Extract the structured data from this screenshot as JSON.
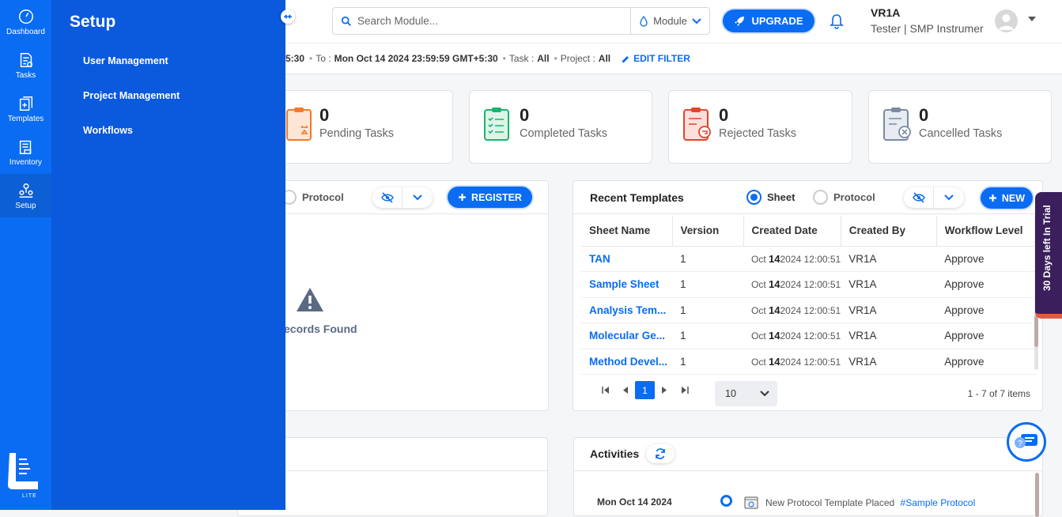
{
  "rail": {
    "items": [
      {
        "label": "Dashboard",
        "icon": "dashboard-icon"
      },
      {
        "label": "Tasks",
        "icon": "tasks-icon"
      },
      {
        "label": "Templates",
        "icon": "templates-icon"
      },
      {
        "label": "Inventory",
        "icon": "inventory-icon"
      },
      {
        "label": "Setup",
        "icon": "setup-icon"
      }
    ],
    "logo_text": "LITE"
  },
  "flyout": {
    "title": "Setup",
    "items": [
      "User Management",
      "Project Management",
      "Workflows"
    ]
  },
  "header": {
    "search_placeholder": "Search Module...",
    "module_label": "Module",
    "upgrade_label": "UPGRADE",
    "user_name": "VR1A",
    "user_role": "Tester | SMP Instrumer"
  },
  "filter": {
    "from_tail": "5:30",
    "to_label": "To :",
    "to_value": "Mon Oct 14 2024 23:59:59 GMT+5:30",
    "task_label": "Task :",
    "task_value": "All",
    "project_label": "Project :",
    "project_value": "All",
    "edit_label": "EDIT FILTER"
  },
  "stats": [
    {
      "count": "0",
      "label": "Pending Tasks"
    },
    {
      "count": "0",
      "label": "Completed Tasks"
    },
    {
      "count": "0",
      "label": "Rejected Tasks"
    },
    {
      "count": "0",
      "label": "Cancelled Tasks"
    }
  ],
  "left_panel": {
    "radio_label": "Protocol",
    "register_label": "REGISTER",
    "empty_text": "ecords Found"
  },
  "templates": {
    "title": "Recent Templates",
    "radio_sheet": "Sheet",
    "radio_protocol": "Protocol",
    "new_label": "NEW",
    "columns": [
      "Sheet Name",
      "Version",
      "Created Date",
      "Created By",
      "Workflow Level"
    ],
    "rows": [
      {
        "name": "TAN",
        "version": "1",
        "month": "Oct",
        "day": "14",
        "rest": "2024 12:00:51",
        "by": "VR1A",
        "level": "Approve"
      },
      {
        "name": "Sample Sheet",
        "version": "1",
        "month": "Oct",
        "day": "14",
        "rest": "2024 12:00:51",
        "by": "VR1A",
        "level": "Approve"
      },
      {
        "name": "Analysis Tem...",
        "version": "1",
        "month": "Oct",
        "day": "14",
        "rest": "2024 12:00:51",
        "by": "VR1A",
        "level": "Approve"
      },
      {
        "name": "Molecular Ge...",
        "version": "1",
        "month": "Oct",
        "day": "14",
        "rest": "2024 12:00:51",
        "by": "VR1A",
        "level": "Approve"
      },
      {
        "name": "Method Devel...",
        "version": "1",
        "month": "Oct",
        "day": "14",
        "rest": "2024 12:00:51",
        "by": "VR1A",
        "level": "Approve"
      }
    ],
    "current_page": "1",
    "page_size": "10",
    "page_info": "1 - 7 of 7 items"
  },
  "activities": {
    "title": "Activities",
    "date": "Mon Oct 14 2024",
    "entry_text": "New Protocol Template Placed",
    "entry_link": "#Sample Protocol"
  },
  "trial_text": "30 Days left In Trial",
  "colors": {
    "primary": "#0a6cf2",
    "flyout": "#0b59dc",
    "trial": "#3a1f5c"
  }
}
